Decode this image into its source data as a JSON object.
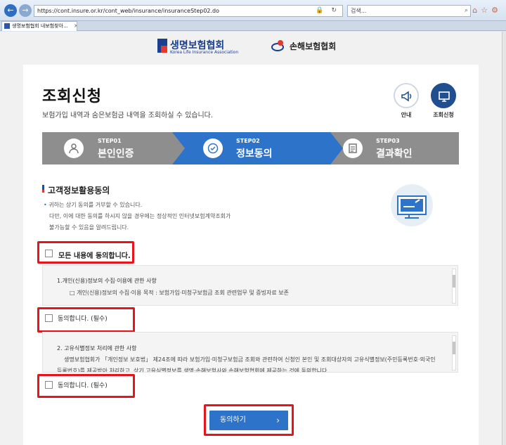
{
  "browser": {
    "url": "https://cont.insure.or.kr/cont_web/insurance/insuranceStep02.do",
    "search_placeholder": "검색...",
    "tab_title": "생명보험협회 내보험찾아..."
  },
  "header": {
    "life_logo_kr": "생명보험협회",
    "life_logo_en": "Korea Life Insurance Association",
    "nonlife_logo_kr": "손해보험협회"
  },
  "page": {
    "title": "조회신청",
    "subtitle": "보험가입 내역과 숨은보험금 내역을 조회하실 수 있습니다.",
    "quick_guide": "안내",
    "quick_request": "조회신청"
  },
  "steps": [
    {
      "no": "STEP01",
      "name": "본인인증"
    },
    {
      "no": "STEP02",
      "name": "정보동의"
    },
    {
      "no": "STEP03",
      "name": "결과확인"
    }
  ],
  "consent": {
    "section_title": "고객정보활용동의",
    "notice_1": "귀하는 상기 동의를 거부할 수 있습니다.",
    "notice_2": "다만, 이에 대한 동의를 하시지 않을 경우에는 정상적인 인터넷보험계약조회가",
    "notice_3": "불가능할 수 있음을 알려드립니다.",
    "agree_all": "모든 내용에 동의합니다.",
    "term1_head": "1.개인(신용)정보의 수집·이용에 관한 사항",
    "term1_body": "□ 개인(신용)정보의 수집·이용 목적 : 보험가입·미청구보험금 조회 관련업무 및 증빙자료 보존",
    "term1_agree": "동의합니다. (필수)",
    "term2_head": "2. 고유식별정보 처리에 관한 사항",
    "term2_body1": "생명보험협회가 「개인정보 보호법」 제24조에 따라 보험가입·미청구보험금 조회와 관련하여 신청인 본인 및 조회대상자의 고유식별정보(주민등록번호·외국인",
    "term2_body2": "등록번호)를 제공받아 처리하고, 상기 고유식별정보를 생명·손해보험사와 손해보험협회에 제공하는 것에 동의합니다.",
    "term2_agree": "동의합니다. (필수)",
    "submit": "동의하기",
    "submit_chevron": "›"
  },
  "colors": {
    "accent": "#2c73c9",
    "highlight": "#e8141c",
    "step_gray": "#8e8e8e",
    "navy": "#1f4f8f"
  }
}
